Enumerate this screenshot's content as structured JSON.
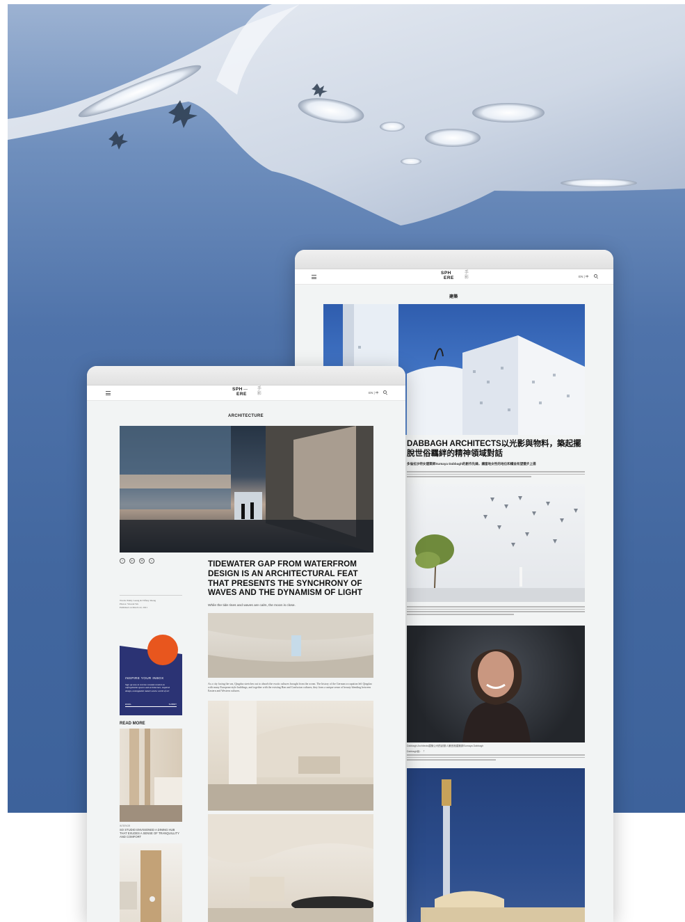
{
  "background": {
    "sky_color": "#44689f",
    "canopy_color": "#dfe4ec"
  },
  "back_window": {
    "logo": {
      "top": "SPH",
      "bottom": "ERE",
      "cn_top": "手",
      "cn_bottom": "影"
    },
    "lang": "EN | 中",
    "section": "建築",
    "headline": "DABBAGH ARCHITECTS以光影與物料，築起擺脫世俗羈絆的精神領域對話",
    "subhead": "多倫拉沙特女建築師Sumaya Dabbagh的創作先鋒，讓當地女性的地位和權益有望獲步上揚",
    "portrait_caption": "Dabbagh Architects建築公司的創辦人兼首席建築師Sumaya Dabbagh",
    "body_intro": "Dabbagh說：「",
    "icons": [
      "menu-icon",
      "search-icon"
    ]
  },
  "front_window": {
    "logo": {
      "top": "SPH",
      "bottom": "ERE",
      "cn_top": "手",
      "cn_bottom": "影"
    },
    "lang": "EN | 中",
    "section": "ARCHITECTURE",
    "headline": "TIDEWATER GAP FROM WATERFROM DESIGN IS AN ARCHITECTURAL FEAT THAT PRESENTS THE SYNCHRONY OF WAVES AND THE DYNAMISM OF LIGHT",
    "standfirst": "While the tide rises and waves are calm, the moon is close.",
    "credits": [
      "Words: Emily Leung & Tiffany Zheng",
      "Photos: Vincent Wu",
      "Published on March 22, 2021"
    ],
    "body_para": "As a city facing the sea, Qingdao stretches out to absorb the exotic cultures brought from the ocean. The history of the German occupation left Qingdao with many European-style buildings, and together with the existing Han and Confucian cultures, they form a unique sense of beauty blending between Eastern and Western cultures.",
    "social_icons": [
      {
        "name": "facebook-icon",
        "glyph": "f"
      },
      {
        "name": "linkedin-icon",
        "glyph": "in"
      },
      {
        "name": "email-icon",
        "glyph": "✉"
      },
      {
        "name": "share-icon",
        "glyph": "<"
      }
    ],
    "newsletter": {
      "title": "INSPIRE YOUR INBOX",
      "description": "Sign up now to receive curated content on unforgettable spaces and architecture, inspired design, unstoppable makers and a world of art",
      "field_label": "EMAIL",
      "submit_label": "SUBMIT",
      "accent_color": "#e8561e"
    },
    "read_more": {
      "label": "READ MORE",
      "card_title": "SO STUDIO ENVISIONED A DINING HUB THAT EXUDES A SENSE OF TRANQUILLITY AND COMFORT",
      "card_kicker": "INTERIOR"
    }
  }
}
